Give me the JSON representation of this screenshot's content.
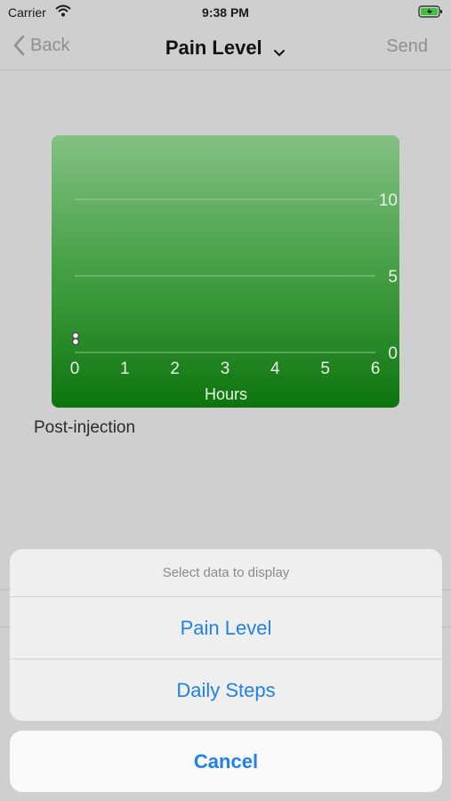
{
  "status_bar": {
    "carrier": "Carrier",
    "time": "9:38 PM"
  },
  "nav": {
    "back_label": "Back",
    "title": "Pain Level",
    "send_label": "Send"
  },
  "chart_data": {
    "type": "scatter",
    "title": "",
    "xlabel": "Hours",
    "ylabel": "",
    "x_ticks": [
      "0",
      "1",
      "2",
      "3",
      "4",
      "5",
      "6"
    ],
    "y_ticks": [
      "0",
      "5",
      "10"
    ],
    "xlim": [
      0,
      6
    ],
    "ylim": [
      0,
      10
    ],
    "grid": true,
    "series": [
      {
        "points": [
          {
            "x": 0,
            "y": 0.7
          },
          {
            "x": 0,
            "y": 1.1
          }
        ]
      }
    ],
    "colors": {
      "background_top": "#84c184",
      "background_bottom": "#0d740d",
      "gridline": "#a9d3a9",
      "label": "#e8f4e8"
    }
  },
  "chart_caption": "Post-injection",
  "action_sheet": {
    "title": "Select data to display",
    "options": [
      {
        "label": "Pain Level"
      },
      {
        "label": "Daily Steps"
      }
    ],
    "cancel_label": "Cancel"
  },
  "colors": {
    "accent": "#1f82e8"
  }
}
